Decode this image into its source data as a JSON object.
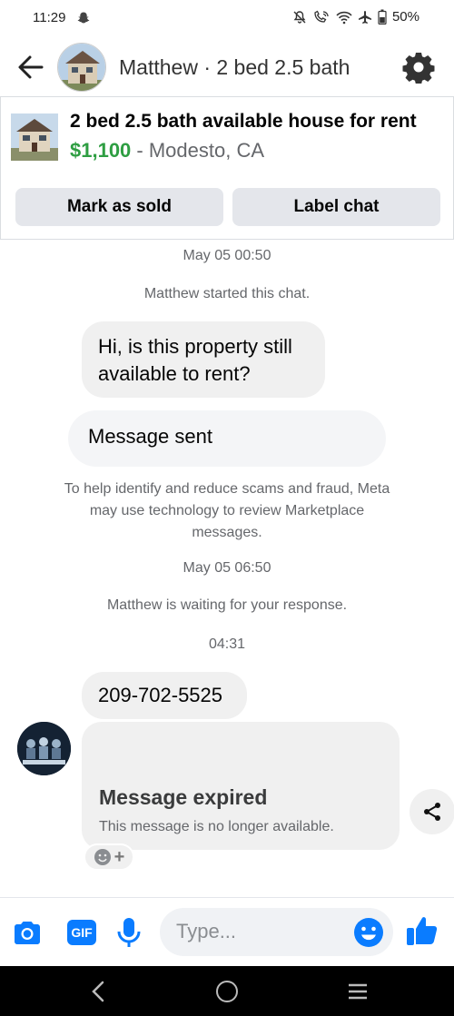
{
  "status_bar": {
    "time": "11:29",
    "battery": "50%"
  },
  "header": {
    "title": "Matthew · 2 bed 2.5 bath"
  },
  "listing": {
    "title": "2 bed 2.5 bath available house for rent",
    "price": "$1,100",
    "separator": " - ",
    "location": "Modesto, CA",
    "mark_sold_label": "Mark as sold",
    "label_chat_label": "Label chat"
  },
  "chat": {
    "timestamp_1": "May 05 00:50",
    "system_started": "Matthew started this chat.",
    "message_1": "Hi, is this property still available to rent?",
    "sent_notice": "Message sent",
    "safety_notice": "To help identify and reduce scams and fraud, Meta may use technology to review Marketplace messages.",
    "timestamp_2": "May 05 06:50",
    "system_waiting": "Matthew is waiting for your response.",
    "timestamp_3": "04:31",
    "phone_message": "209-702-5525",
    "expired_title": "Message expired",
    "expired_desc": "This message is no longer available."
  },
  "composer": {
    "gif_label": "GIF",
    "placeholder": "Type..."
  },
  "colors": {
    "accent": "#0a7cff",
    "price": "#2e9e42",
    "bubble": "#f0f0f0"
  },
  "icons": [
    "snapchat-icon",
    "mute-icon",
    "wifi-call-icon",
    "wifi-icon",
    "airplane-icon",
    "battery-icon",
    "back-arrow-icon",
    "gear-icon",
    "share-icon",
    "smiley-icon",
    "camera-icon",
    "mic-icon",
    "like-icon"
  ]
}
